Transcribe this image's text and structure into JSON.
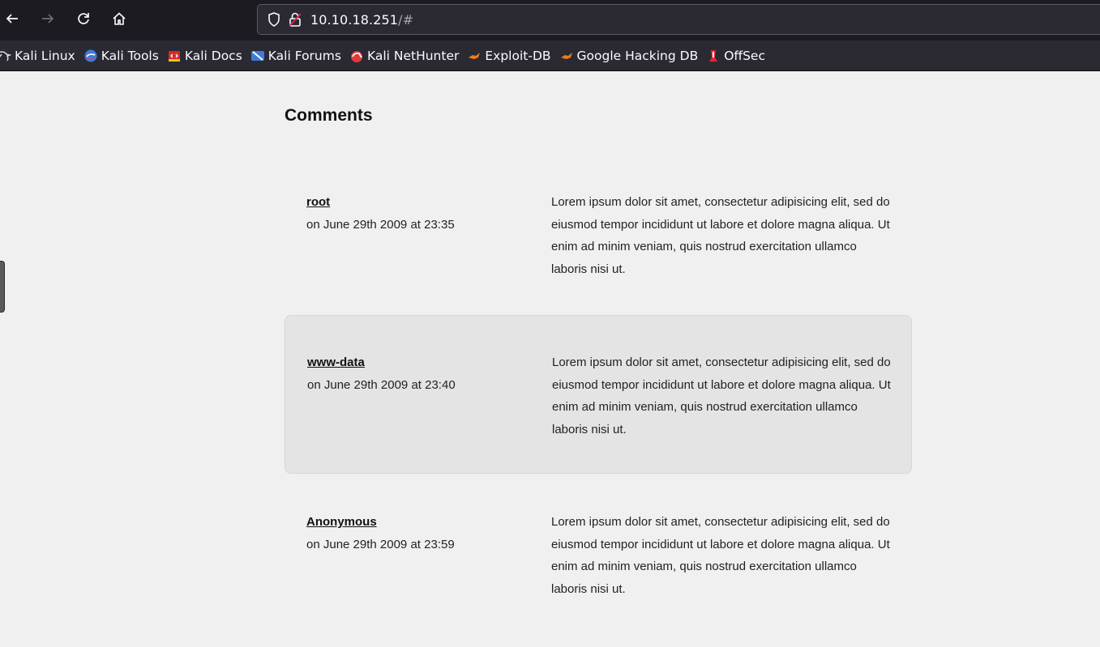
{
  "browser": {
    "url_host": "10.10.18.251",
    "url_rest": "/#",
    "bookmarks": [
      {
        "label": "Kali Linux",
        "icon": "kali-dragon-icon"
      },
      {
        "label": "Kali Tools",
        "icon": "kali-tools-icon"
      },
      {
        "label": "Kali Docs",
        "icon": "kali-docs-icon"
      },
      {
        "label": "Kali Forums",
        "icon": "kali-forums-icon"
      },
      {
        "label": "Kali NetHunter",
        "icon": "kali-nethunter-icon"
      },
      {
        "label": "Exploit-DB",
        "icon": "exploit-db-icon"
      },
      {
        "label": "Google Hacking DB",
        "icon": "google-hacking-db-icon"
      },
      {
        "label": "OffSec",
        "icon": "offsec-icon"
      }
    ]
  },
  "page": {
    "title": "Comments",
    "comments": [
      {
        "author": "root",
        "date": "on June 29th 2009 at 23:35",
        "body": "Lorem ipsum dolor sit amet, consectetur adipisicing elit, sed do eiusmod tempor incididunt ut labore et dolore magna aliqua. Ut enim ad minim veniam, quis nostrud exercitation ullamco laboris nisi ut."
      },
      {
        "author": "www-data",
        "date": "on June 29th 2009 at 23:40",
        "body": "Lorem ipsum dolor sit amet, consectetur adipisicing elit, sed do eiusmod tempor incididunt ut labore et dolore magna aliqua. Ut enim ad minim veniam, quis nostrud exercitation ullamco laboris nisi ut."
      },
      {
        "author": "Anonymous",
        "date": "on June 29th 2009 at 23:59",
        "body": "Lorem ipsum dolor sit amet, consectetur adipisicing elit, sed do eiusmod tempor incididunt ut labore et dolore magna aliqua. Ut enim ad minim veniam, quis nostrud exercitation ullamco laboris nisi ut."
      }
    ]
  },
  "colors": {
    "toolbar_bg": "#1c1b22",
    "urlbar_bg": "#2b2a33",
    "page_bg": "#f0f0f0",
    "highlight_card_bg": "#e4e4e4",
    "insecure_lock_red": "#e22850"
  }
}
